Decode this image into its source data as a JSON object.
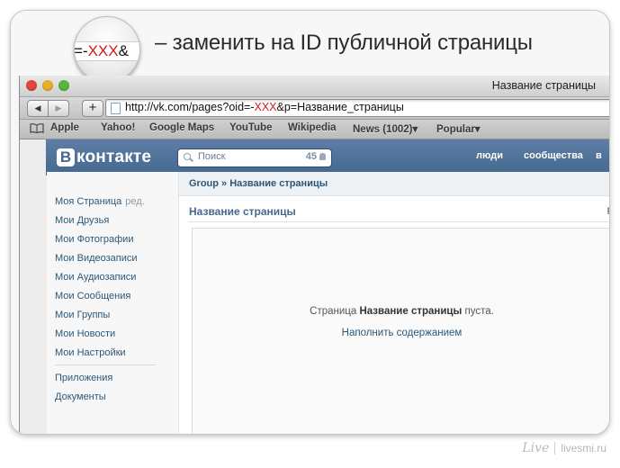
{
  "header": {
    "magnifier_prefix": "=-",
    "magnifier_red": "XXX",
    "magnifier_suffix": "&",
    "instruction": "– заменить на ID публичной страницы"
  },
  "browser": {
    "window_title": "Название страницы",
    "url_before": "http://vk.com/pages?oid=-",
    "url_red": "XXX",
    "url_after": "&p=Название_страницы",
    "back_label": "◀",
    "forward_label": "▶",
    "add_label": "+",
    "bookmarks": [
      "Apple",
      "Yahoo!",
      "Google Maps",
      "YouTube",
      "Wikipedia",
      "News (1002)▾",
      "Popular▾"
    ]
  },
  "vk": {
    "logo_letter": "В",
    "logo_word": "контакте",
    "search_placeholder": "Поиск",
    "online_count": "45",
    "nav": [
      "люди",
      "сообщества",
      "в"
    ],
    "menu": {
      "my_page": "Моя Страница",
      "edit": "ред.",
      "items": [
        "Мои Друзья",
        "Мои Фотографии",
        "Мои Видеозаписи",
        "Мои Аудиозаписи",
        "Мои Сообщения",
        "Мои Группы",
        "Мои Новости",
        "Мои Настройки"
      ],
      "extra": [
        "Приложения",
        "Документы"
      ]
    },
    "breadcrumb": "Group » Название страницы",
    "page_title": "Название страницы",
    "right_link": "Р",
    "empty_prefix": "Страница ",
    "empty_name": "Название страницы",
    "empty_suffix": " пуста.",
    "fill_link": "Наполнить содержанием"
  },
  "footer": {
    "brand": "Live",
    "site": "livesmi.ru"
  }
}
